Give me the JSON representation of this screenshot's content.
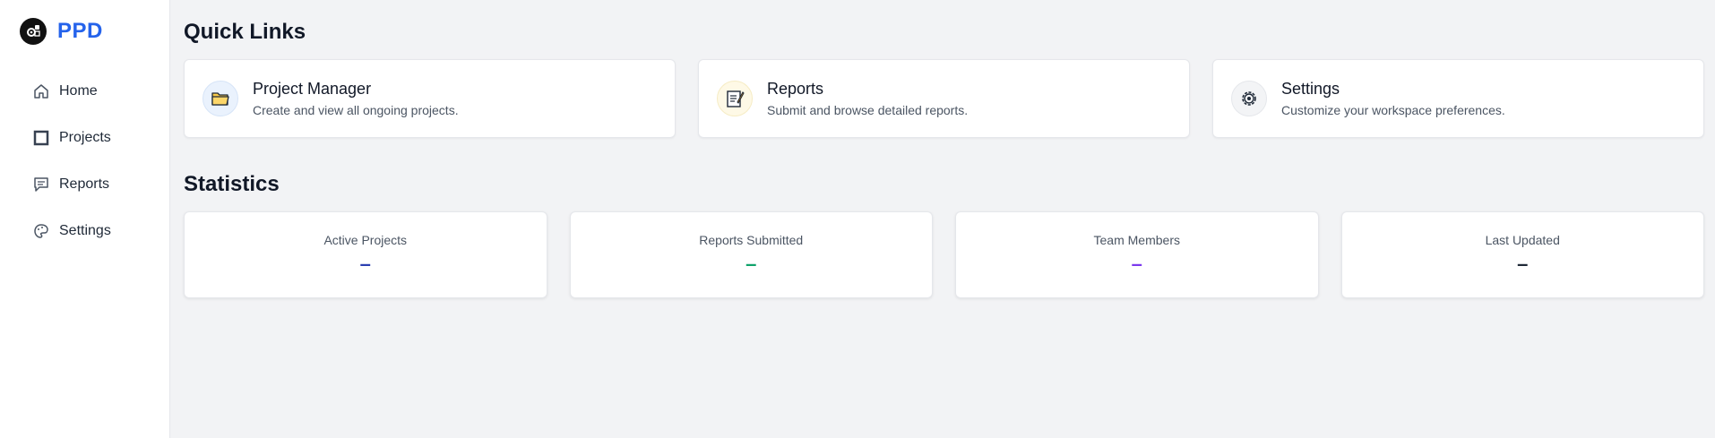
{
  "brand": {
    "name": "PPD",
    "logo_icon": "gear-icon"
  },
  "sidebar": {
    "items": [
      {
        "label": "Home",
        "icon": "home-icon"
      },
      {
        "label": "Projects",
        "icon": "square-icon"
      },
      {
        "label": "Reports",
        "icon": "chat-icon"
      },
      {
        "label": "Settings",
        "icon": "palette-icon"
      }
    ]
  },
  "quick_links": {
    "title": "Quick Links",
    "cards": [
      {
        "title": "Project Manager",
        "description": "Create and view all ongoing projects.",
        "icon": "folder-icon"
      },
      {
        "title": "Reports",
        "description": "Submit and browse detailed reports.",
        "icon": "memo-icon"
      },
      {
        "title": "Settings",
        "description": "Customize your workspace preferences.",
        "icon": "gear-icon"
      }
    ]
  },
  "statistics": {
    "title": "Statistics",
    "cards": [
      {
        "label": "Active Projects",
        "value": "–",
        "color": "#2c3fb1"
      },
      {
        "label": "Reports Submitted",
        "value": "–",
        "color": "#10a36b"
      },
      {
        "label": "Team Members",
        "value": "–",
        "color": "#7c3aed"
      },
      {
        "label": "Last Updated",
        "value": "–",
        "color": "#1f2937"
      }
    ]
  },
  "colors": {
    "brand": "#2563eb",
    "background": "#f2f3f5"
  }
}
